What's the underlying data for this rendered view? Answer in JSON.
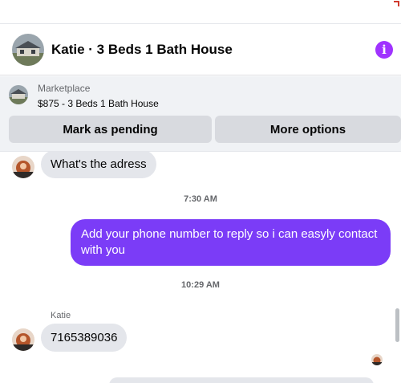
{
  "header": {
    "title": "Katie · 3 Beds 1 Bath House",
    "info_icon": "info-icon",
    "info_glyph": "i",
    "accent_color": "#a033ff"
  },
  "marketplace": {
    "label": "Marketplace",
    "listing": "$875 - 3 Beds 1 Bath House",
    "buttons": {
      "pending": "Mark as pending",
      "more": "More options"
    }
  },
  "chat": {
    "messages": [
      {
        "from": "Katie",
        "text": "What's the adress"
      },
      {
        "timestamp": "7:30 AM"
      },
      {
        "from": "me",
        "text": "Add your phone number to reply so i can easyly contact with you"
      },
      {
        "timestamp": "10:29 AM"
      },
      {
        "sender_label": "Katie",
        "from": "Katie",
        "text": "7165389036"
      }
    ],
    "outgoing_color": "#7b3cf7",
    "incoming_color": "#e4e6eb"
  }
}
